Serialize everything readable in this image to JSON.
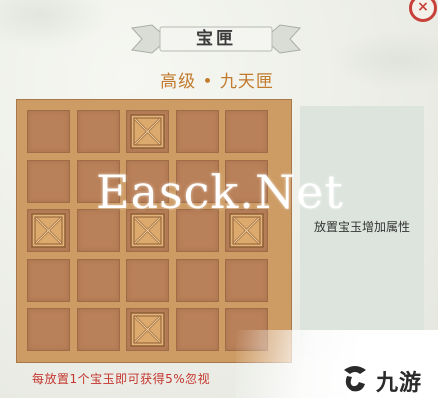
{
  "title": "宝匣",
  "subtitle": "高级 • 九天匣",
  "close_icon_glyph": "×",
  "grid": {
    "rows": 5,
    "cols": 5,
    "crate_cells": [
      [
        0,
        2
      ],
      [
        2,
        0
      ],
      [
        2,
        2
      ],
      [
        2,
        4
      ],
      [
        4,
        2
      ]
    ]
  },
  "side_panel": {
    "hint": "放置宝玉增加属性"
  },
  "footer_note": "每放置1个宝玉即可获得5%忽视",
  "watermark": "Easck.Net",
  "logo": {
    "text": "九游",
    "icon": "j9-logo-icon"
  },
  "colors": {
    "board": "#cd9b64",
    "cell": "#b98159",
    "subtitle": "#c27a2c",
    "note": "#c5352f",
    "close": "#c7413a"
  }
}
